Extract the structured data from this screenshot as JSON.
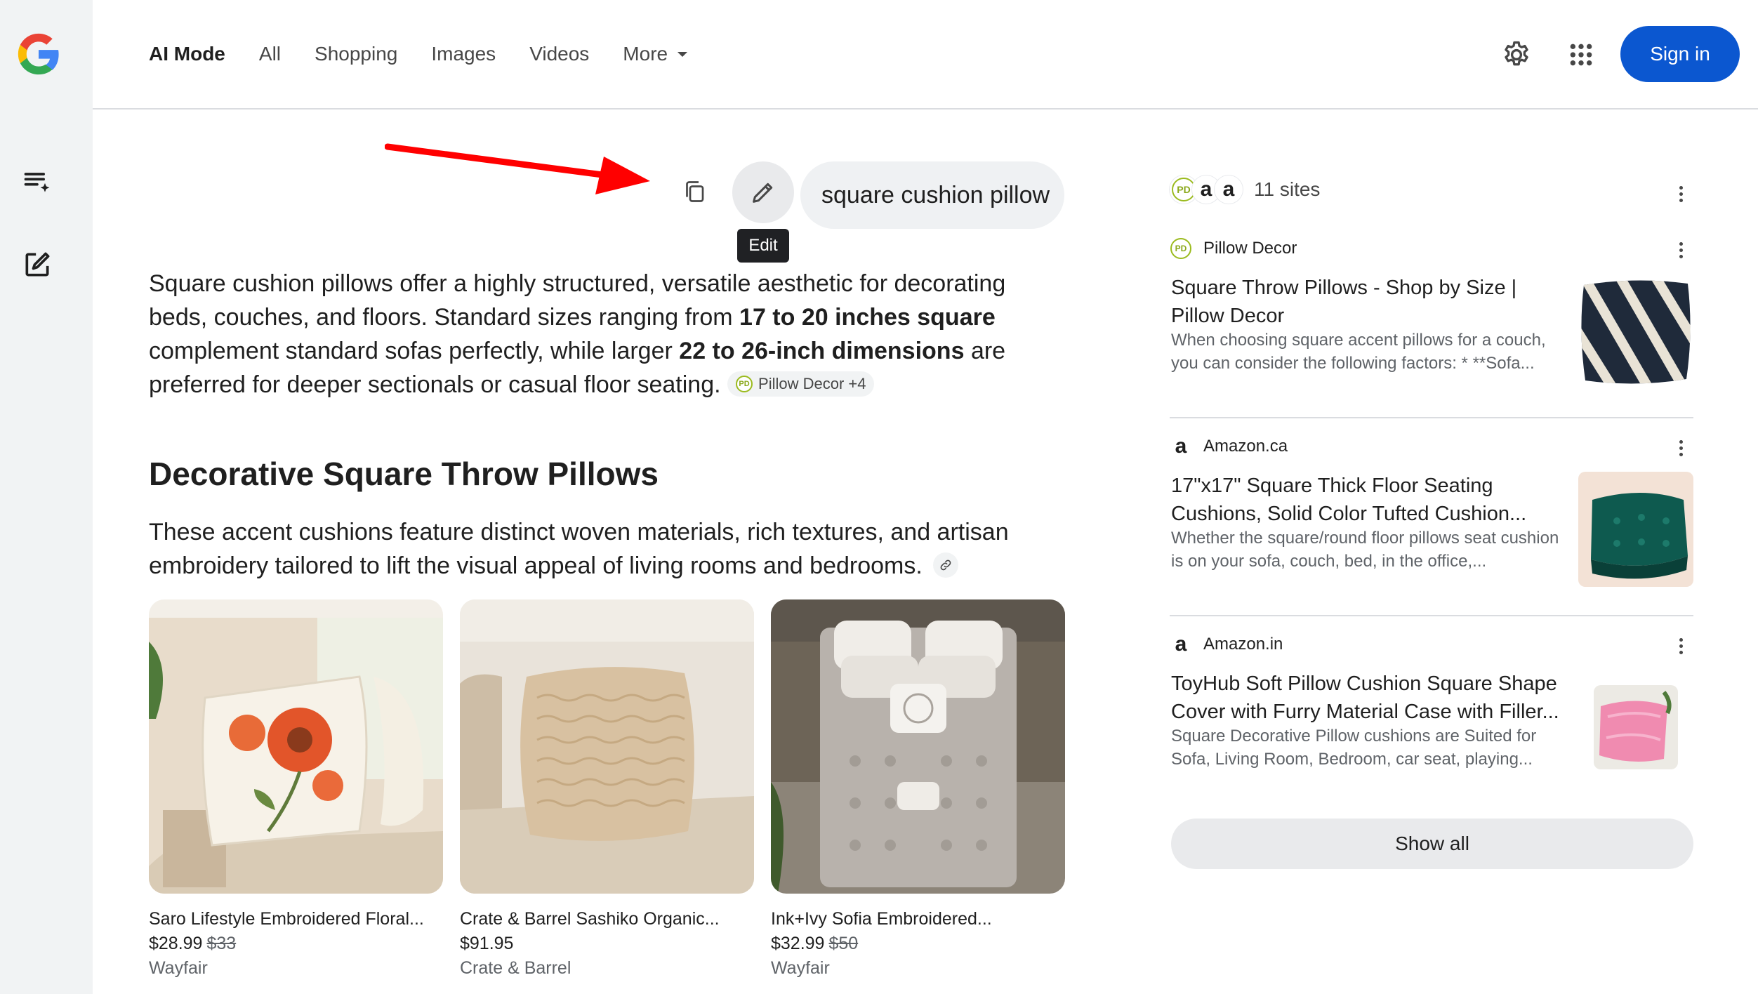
{
  "nav": {
    "tabs": [
      "AI Mode",
      "All",
      "Shopping",
      "Images",
      "Videos",
      "More"
    ],
    "sign_in": "Sign in"
  },
  "query": {
    "text": "square cushion pillow",
    "edit_tooltip": "Edit"
  },
  "answer": {
    "p1": "Square cushion pillows offer a highly structured, versatile aesthetic for decorating beds, couches, and floors. Standard sizes ranging from ",
    "b1": "17 to 20 inches square",
    "p2": " complement standard sofas perfectly, while larger ",
    "b2": "22 to 26-inch dimensions",
    "p3": " are preferred for deeper sectionals or casual floor seating.",
    "citation": "Pillow Decor +4"
  },
  "section": {
    "title": "Decorative Square Throw Pillows",
    "description": "These accent cushions feature distinct woven materials, rich textures, and artisan embroidery tailored to lift the visual appeal of living rooms and bedrooms."
  },
  "products": [
    {
      "name": "Saro Lifestyle Embroidered Floral...",
      "price": "$28.99",
      "old_price": "$33",
      "store": "Wayfair"
    },
    {
      "name": "Crate & Barrel Sashiko Organic...",
      "price": "$91.95",
      "old_price": "",
      "store": "Crate & Barrel"
    },
    {
      "name": "Ink+Ivy Sofia Embroidered...",
      "price": "$32.99",
      "old_price": "$50",
      "store": "Wayfair"
    }
  ],
  "sources": {
    "count_label": "11 sites",
    "items": [
      {
        "site": "Pillow Decor",
        "title": "Square Throw Pillows - Shop by Size | Pillow Decor",
        "snippet": "When choosing square accent pillows for a couch, you can consider the following factors: * **Sofa..."
      },
      {
        "site": "Amazon.ca",
        "title": "17\"x17\" Square Thick Floor Seating Cushions, Solid Color Tufted Cushion...",
        "snippet": "Whether the square/round floor pillows seat cushion is on your sofa, couch, bed, in the office,..."
      },
      {
        "site": "Amazon.in",
        "title": "ToyHub Soft Pillow Cushion Square Shape Cover with Furry Material Case with Filler...",
        "snippet": "Square Decorative Pillow cushions are Suited for Sofa, Living Room, Bedroom, car seat, playing..."
      }
    ],
    "show_all": "Show all"
  },
  "colors": {
    "accent": "#0b57d0",
    "annotation_arrow": "#ff0000"
  }
}
